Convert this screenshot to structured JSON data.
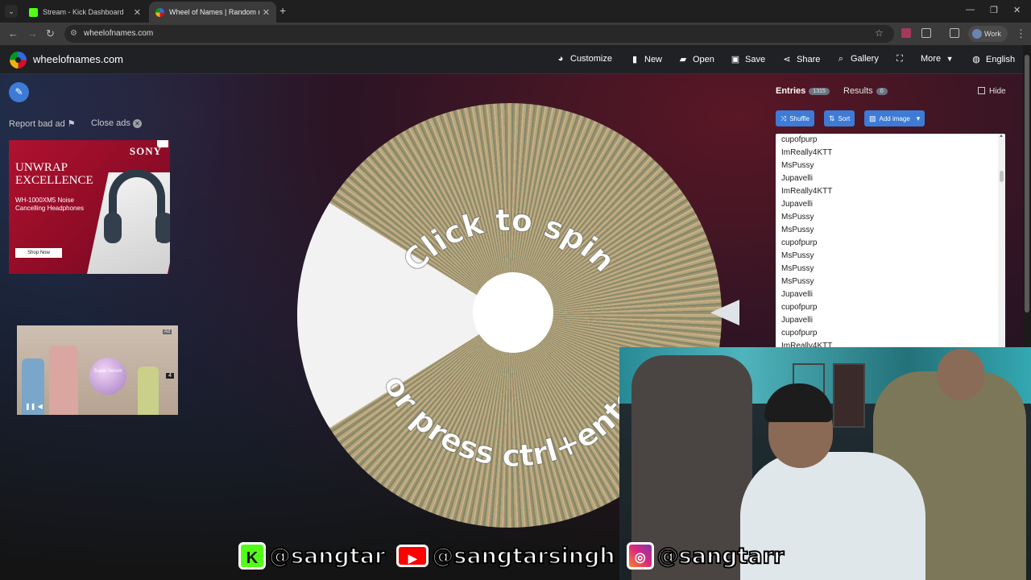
{
  "browser": {
    "tabs": [
      {
        "title": "Stream - Kick Dashboard",
        "favicon_color": "#53fc18"
      },
      {
        "title": "Wheel of Names | Random nam",
        "favicon_color": "#e8a317"
      }
    ],
    "url": "wheelofnames.com",
    "profile_label": "Work"
  },
  "site": {
    "brand": "wheelofnames.com",
    "menu": [
      {
        "label": "Customize",
        "icon": "palette-icon"
      },
      {
        "label": "New",
        "icon": "new-file-icon"
      },
      {
        "label": "Open",
        "icon": "folder-icon"
      },
      {
        "label": "Save",
        "icon": "save-icon"
      },
      {
        "label": "Share",
        "icon": "share-icon"
      },
      {
        "label": "Gallery",
        "icon": "search-icon"
      },
      {
        "label": "",
        "icon": "fullscreen-icon"
      },
      {
        "label": "More",
        "icon": "chevron-down-icon"
      },
      {
        "label": "English",
        "icon": "globe-icon"
      }
    ]
  },
  "left": {
    "report_label": "Report bad ad",
    "close_ads_label": "Close ads"
  },
  "ad1": {
    "brand": "SONY",
    "headline": "UNWRAP EXCELLENCE",
    "subline": "WH-1000XM5 Noise Cancelling Headphones",
    "cta": "Shop Now"
  },
  "ad2": {
    "ad_label": "Ad",
    "counter": "4",
    "product_text": "Super Serum"
  },
  "wheel": {
    "top_text": "Click to spin",
    "bottom_text": "or press ctrl+enter"
  },
  "panel": {
    "entries_tab": "Entries",
    "entries_count": "1315",
    "results_tab": "Results",
    "results_count": "0",
    "hide_label": "Hide",
    "shuffle_label": "Shuffle",
    "sort_label": "Sort",
    "add_image_label": "Add image",
    "entries": [
      "cupofpurp",
      "ImReally4KTT",
      "MsPussy",
      "Jupavelli",
      "ImReally4KTT",
      "Jupavelli",
      "MsPussy",
      "MsPussy",
      "cupofpurp",
      "MsPussy",
      "MsPussy",
      "MsPussy",
      "Jupavelli",
      "cupofpurp",
      "Jupavelli",
      "cupofpurp",
      "ImReally4KTT"
    ]
  },
  "social": [
    {
      "platform": "kick",
      "handle": "@sangtar",
      "color": "#53fc18"
    },
    {
      "platform": "youtube",
      "handle": "@sangtarsingh",
      "color": "#ff0000"
    },
    {
      "platform": "instagram",
      "handle": "@sangtarr",
      "color": "#d6249f"
    }
  ]
}
